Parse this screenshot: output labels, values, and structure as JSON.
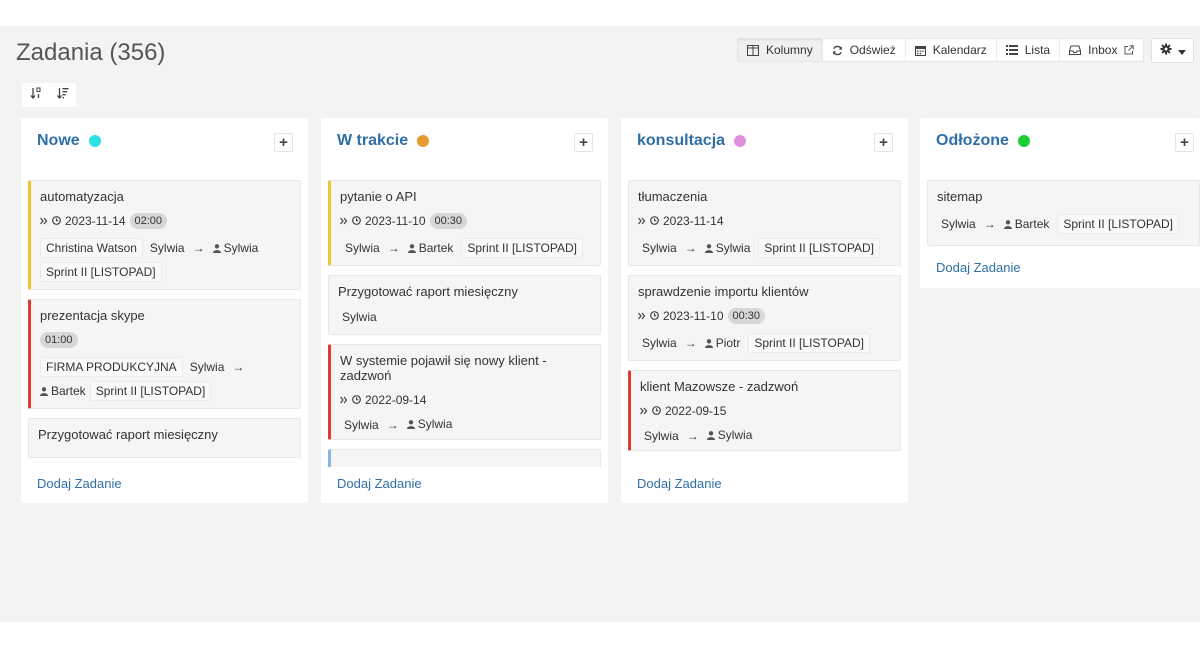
{
  "page": {
    "title": "Zadania (356)"
  },
  "toolbar": {
    "columns": "Kolumny",
    "refresh": "Odśwież",
    "calendar": "Kalendarz",
    "list": "Lista",
    "inbox": "Inbox"
  },
  "colors": {
    "nowe": "#2ce0e6",
    "w_trakcie": "#e69b2e",
    "konsultacja": "#df8ee0",
    "odlozone": "#22cc33",
    "title_blue": "#2f6fa8",
    "stripe_yellow": "#f1c232",
    "stripe_red": "#e03b32"
  },
  "icons": [
    "columns-icon",
    "refresh-icon",
    "calendar-icon",
    "list-icon",
    "inbox-icon",
    "external-link-icon",
    "gear-icon",
    "caret-down-icon",
    "sort-numeric-icon",
    "sort-amount-icon",
    "plus-icon",
    "double-chevron-icon",
    "clock-icon",
    "user-icon",
    "arrow-right-icon"
  ],
  "columns": [
    {
      "title": "Nowe",
      "add_label": "+",
      "add_task": "Dodaj Zadanie",
      "cards": [
        {
          "title": "automatyzacja",
          "date": "2023-11-14",
          "duration": "02:00",
          "client": "Christina Watson",
          "from": "Sylwia",
          "arrow": "→",
          "to": "Sylwia",
          "sprint": "Sprint II [LISTOPAD]"
        },
        {
          "title": "prezentacja skype",
          "duration": "01:00",
          "client": "FIRMA PRODUKCYJNA",
          "from": "Sylwia",
          "arrow": "→",
          "to": "Bartek",
          "sprint": "Sprint II [LISTOPAD]"
        },
        {
          "title": "Przygotować raport miesięczny"
        }
      ]
    },
    {
      "title": "W trakcie",
      "add_label": "+",
      "add_task": "Dodaj Zadanie",
      "cards": [
        {
          "title": "pytanie o API",
          "date": "2023-11-10",
          "duration": "00:30",
          "from": "Sylwia",
          "arrow": "→",
          "to": "Bartek",
          "sprint": "Sprint II [LISTOPAD]"
        },
        {
          "title": "Przygotować raport miesięczny",
          "from": "Sylwia"
        },
        {
          "title": "W systemie pojawił się nowy klient - zadzwoń",
          "date": "2022-09-14",
          "from": "Sylwia",
          "arrow": "→",
          "to": "Sylwia"
        }
      ]
    },
    {
      "title": "konsultacja",
      "add_label": "+",
      "add_task": "Dodaj Zadanie",
      "cards": [
        {
          "title": "tłumaczenia",
          "date": "2023-11-14",
          "from": "Sylwia",
          "arrow": "→",
          "to": "Sylwia",
          "sprint": "Sprint II [LISTOPAD]"
        },
        {
          "title": "sprawdzenie importu klientów",
          "date": "2023-11-10",
          "duration": "00:30",
          "from": "Sylwia",
          "arrow": "→",
          "to": "Piotr",
          "sprint": "Sprint II [LISTOPAD]"
        },
        {
          "title": "klient Mazowsze - zadzwoń",
          "date": "2022-09-15",
          "from": "Sylwia",
          "arrow": "→",
          "to": "Sylwia"
        }
      ]
    },
    {
      "title": "Odłożone",
      "add_label": "+",
      "add_task": "Dodaj Zadanie",
      "cards": [
        {
          "title": "sitemap",
          "from": "Sylwia",
          "arrow": "→",
          "to": "Bartek",
          "sprint": "Sprint II [LISTOPAD]"
        }
      ]
    }
  ]
}
